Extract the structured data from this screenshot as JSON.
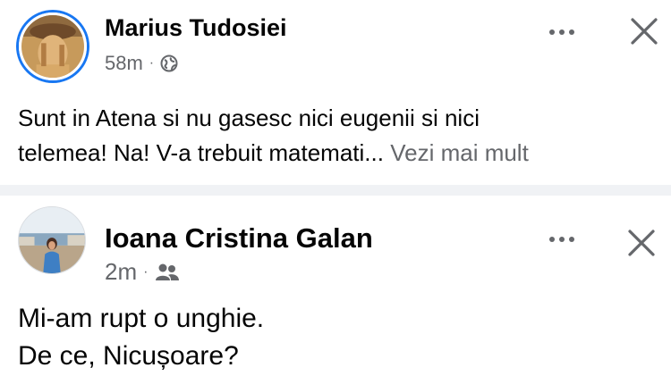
{
  "posts": [
    {
      "author": "Marius Tudosiei",
      "time": "58m",
      "meta_separator": "·",
      "audience_icon": "globe-icon",
      "text_line1": "Sunt in Atena si nu gasesc nici eugenii si nici",
      "text_line2": "telemea! Na! V-a trebuit matemati...",
      "see_more": "Vezi mai mult",
      "avatar_story_ring_color": "#1877f2"
    },
    {
      "author": "Ioana Cristina Galan",
      "time": "2m",
      "meta_separator": "·",
      "audience_icon": "friends-icon",
      "text_line1": "Mi-am rupt o unghie.",
      "text_line2": "De ce, Nicușoare?"
    }
  ],
  "icons": {
    "more": "more-options-icon",
    "close": "close-icon"
  },
  "colors": {
    "primary_text": "#050505",
    "secondary_text": "#65676b",
    "separator": "#f0f2f5",
    "accent": "#1877f2"
  }
}
